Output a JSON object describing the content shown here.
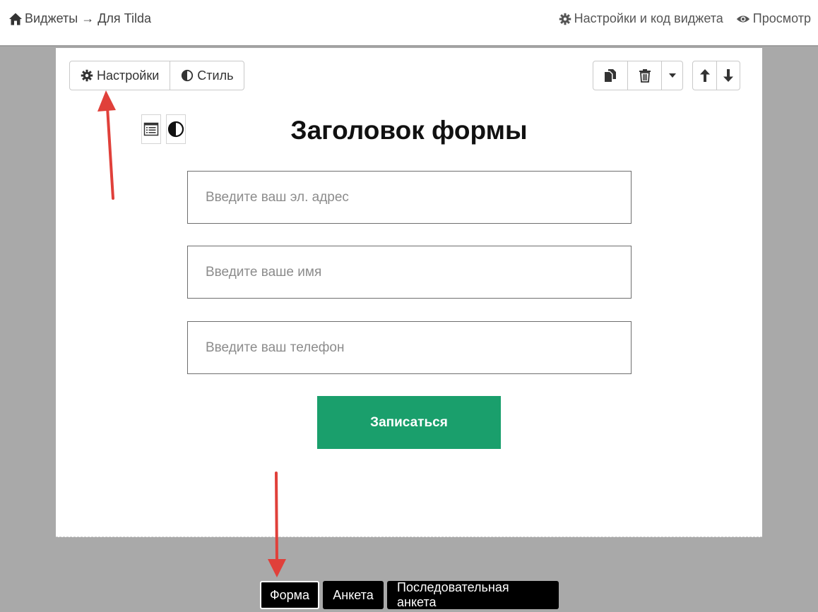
{
  "header": {
    "breadcrumb": {
      "icon": "home-icon",
      "text": "Виджеты → Для Tilda"
    },
    "links": [
      {
        "icon": "gear-icon",
        "label": "Настройки и код виджета"
      },
      {
        "icon": "eye-icon",
        "label": "Просмотр"
      }
    ]
  },
  "toolbar": {
    "settings_label": "Настройки",
    "style_label": "Стиль",
    "settings_icon": "gear-icon",
    "style_icon": "half-circle-icon",
    "actions": [
      {
        "icon": "copy-icon"
      },
      {
        "icon": "trash-icon"
      },
      {
        "icon": "caret-down-icon"
      }
    ],
    "move": [
      {
        "icon": "arrow-up-icon"
      },
      {
        "icon": "arrow-down-icon"
      }
    ]
  },
  "block_tools": [
    {
      "icon": "form-layout-icon"
    },
    {
      "icon": "half-circle-icon"
    }
  ],
  "form": {
    "title": "Заголовок формы",
    "fields": [
      {
        "placeholder": "Введите ваш эл. адрес",
        "value": ""
      },
      {
        "placeholder": "Введите ваше имя",
        "value": ""
      },
      {
        "placeholder": "Введите ваш телефон",
        "value": ""
      }
    ],
    "submit_label": "Записаться",
    "submit_color": "#1a9f6c"
  },
  "tabs": [
    {
      "label": "Форма",
      "active": true
    },
    {
      "label": "Анкета",
      "active": false
    },
    {
      "label": "Последовательная анкета",
      "active": false
    }
  ],
  "annotations": {
    "arrow_color": "#e0403a"
  }
}
